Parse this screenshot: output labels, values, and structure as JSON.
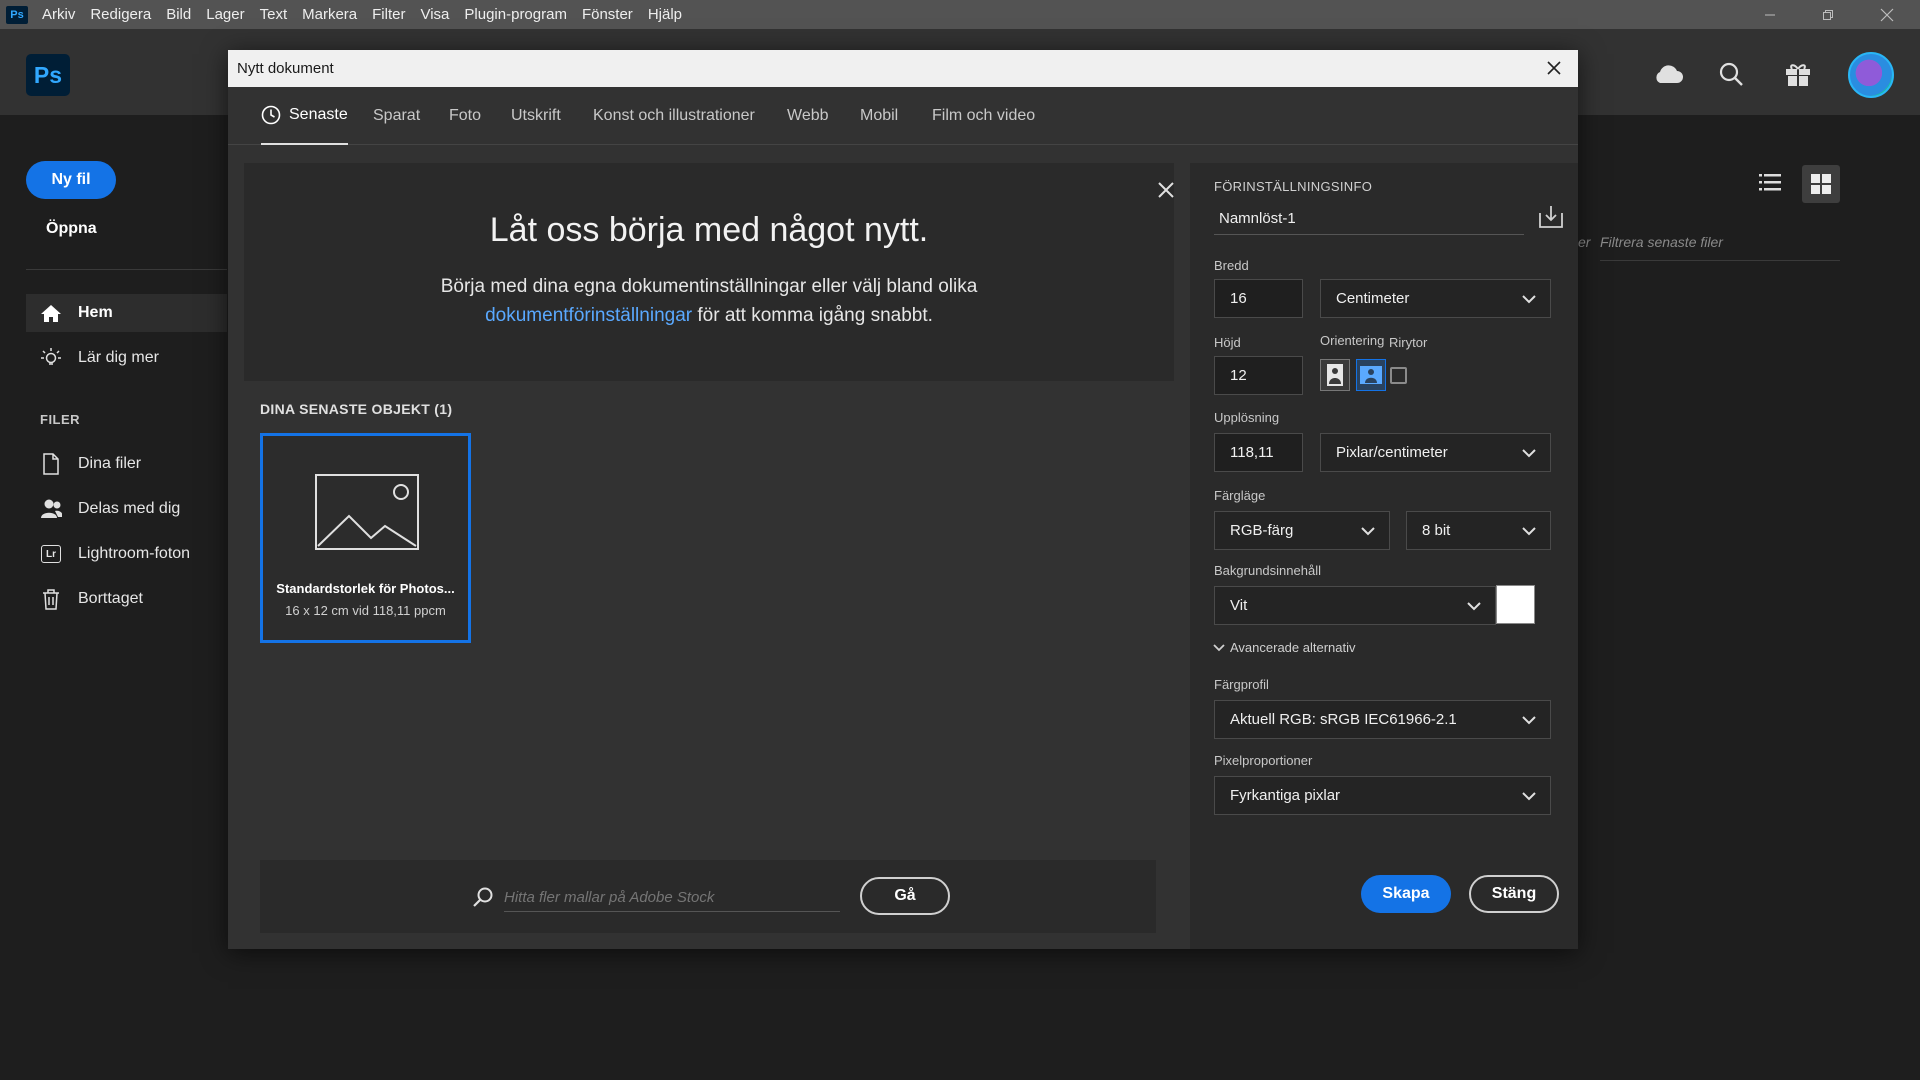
{
  "menubar": {
    "logo": "Ps",
    "items": [
      "Arkiv",
      "Redigera",
      "Bild",
      "Lager",
      "Text",
      "Markera",
      "Filter",
      "Visa",
      "Plugin-program",
      "Fönster",
      "Hjälp"
    ]
  },
  "app": {
    "logo": "Ps"
  },
  "sidebar": {
    "new_file": "Ny fil",
    "open": "Öppna",
    "nav": [
      {
        "label": "Hem",
        "icon": "home-icon"
      },
      {
        "label": "Lär dig mer",
        "icon": "lightbulb-icon"
      }
    ],
    "files_heading": "FILER",
    "files": [
      {
        "label": "Dina filer",
        "icon": "file-icon"
      },
      {
        "label": "Delas med dig",
        "icon": "users-icon"
      },
      {
        "label": "Lightroom-foton",
        "icon": "lightroom-icon",
        "badge": "Lr"
      },
      {
        "label": "Borttaget",
        "icon": "trash-icon"
      }
    ]
  },
  "background": {
    "filter_placeholder": "Filtrera senaste filer",
    "filter_prefix": "er"
  },
  "dialog": {
    "title": "Nytt dokument",
    "tabs": [
      "Senaste",
      "Sparat",
      "Foto",
      "Utskrift",
      "Konst och illustrationer",
      "Webb",
      "Mobil",
      "Film och video"
    ],
    "hero": {
      "heading": "Låt oss börja med något nytt.",
      "text_before": "Börja med dina egna dokumentinställningar eller välj bland olika ",
      "link": "dokumentförinställningar",
      "text_after": " för att komma igång snabbt."
    },
    "recent_title": "DINA SENASTE OBJEKT  (1)",
    "recent_item": {
      "name": "Standardstorlek för Photos...",
      "detail": "16 x 12 cm vid 118,11 ppcm"
    },
    "stock": {
      "placeholder": "Hitta fler mallar på Adobe Stock",
      "go": "Gå"
    },
    "preset": {
      "heading": "FÖRINSTÄLLNINGSINFO",
      "name": "Namnlöst-1",
      "width_label": "Bredd",
      "width": "16",
      "width_unit": "Centimeter",
      "height_label": "Höjd",
      "height": "12",
      "orientation_label": "Orientering",
      "artboards_label": "Rirytor",
      "resolution_label": "Upplösning",
      "resolution": "118,11",
      "resolution_unit": "Pixlar/centimeter",
      "color_mode_label": "Färgläge",
      "color_mode": "RGB-färg",
      "bit_depth": "8 bit",
      "background_label": "Bakgrundsinnehåll",
      "background": "Vit",
      "background_color": "#ffffff",
      "advanced": "Avancerade alternativ",
      "profile_label": "Färgprofil",
      "profile": "Aktuell RGB: sRGB IEC61966-2.1",
      "pixel_label": "Pixelproportioner",
      "pixel": "Fyrkantiga pixlar",
      "create": "Skapa",
      "close": "Stäng"
    }
  },
  "colors": {
    "accent": "#1473e6",
    "link": "#5aa9ff"
  }
}
